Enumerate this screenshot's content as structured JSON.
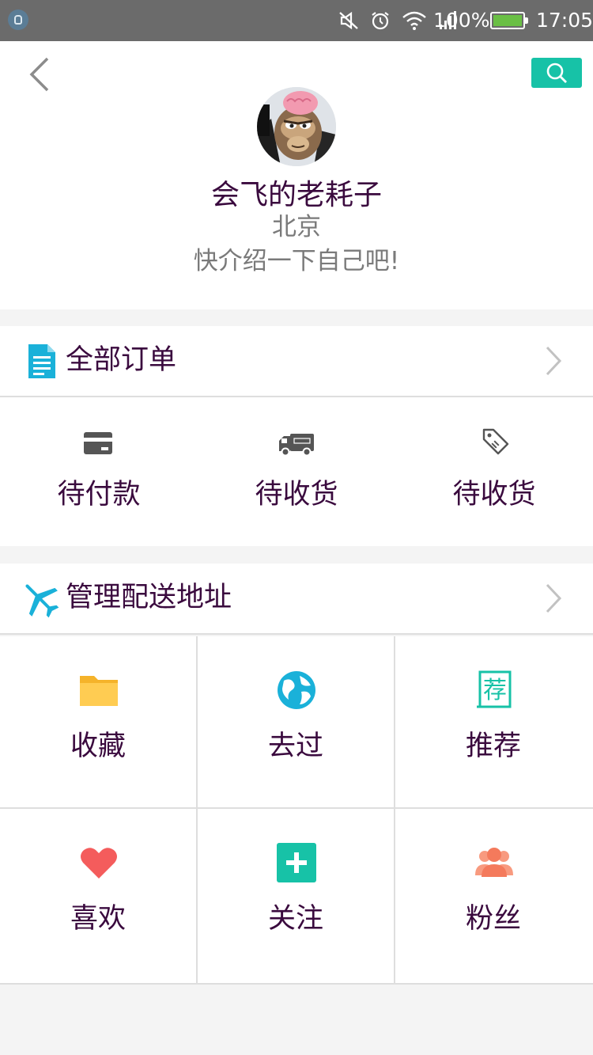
{
  "status_bar": {
    "battery": "100%",
    "time": "17:05"
  },
  "profile": {
    "username": "会飞的老耗子",
    "city": "北京",
    "bio": "快介绍一下自己吧!"
  },
  "orders": {
    "title": "全部订单",
    "items": [
      {
        "label": "待付款",
        "icon": "card-icon"
      },
      {
        "label": "待收货",
        "icon": "truck-icon"
      },
      {
        "label": "待收货",
        "icon": "tag-icon"
      }
    ]
  },
  "address": {
    "title": "管理配送地址",
    "icon": "airplane-icon"
  },
  "grid": [
    {
      "label": "收藏",
      "icon": "folder-icon",
      "color": "#ffc94a"
    },
    {
      "label": "去过",
      "icon": "globe-icon",
      "color": "#1ab1d9"
    },
    {
      "label": "推荐",
      "icon": "recommend-icon",
      "color": "#17c2a7"
    },
    {
      "label": "喜欢",
      "icon": "heart-icon",
      "color": "#f45c5c"
    },
    {
      "label": "关注",
      "icon": "plus-icon",
      "color": "#17c2a7"
    },
    {
      "label": "粉丝",
      "icon": "fans-icon",
      "color": "#f47a5c"
    }
  ],
  "colors": {
    "accent": "#17c2a7",
    "text": "#3a0a3e",
    "muted": "#7a7a7a"
  }
}
